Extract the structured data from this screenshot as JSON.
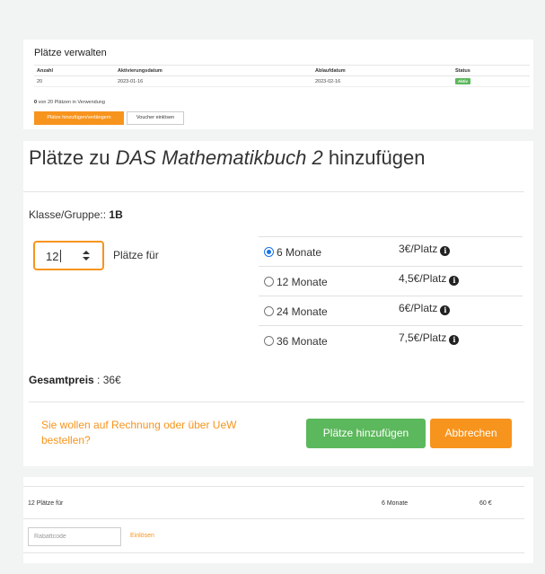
{
  "manage": {
    "title": "Plätze verwalten",
    "headers": [
      "Anzahl",
      "Aktivierungsdatum",
      "Ablaufdatum",
      "Status"
    ],
    "row": {
      "count": "20",
      "activation": "2023-01-16",
      "expiry": "2023-02-16",
      "status": "Aktiv"
    },
    "usage_count": "0",
    "usage_text": " von 20 Plätzen in Verwendung",
    "add_extend_label": "Plätze hinzufügen/verlängern",
    "voucher_label": "Voucher einlösen"
  },
  "add": {
    "title_prefix": "Plätze zu ",
    "title_book": "DAS Mathematikbuch 2",
    "title_suffix": " hinzufügen",
    "class_label": "Klasse/Gruppe:: ",
    "class_value": "1B",
    "quantity": "12",
    "places_for": "Plätze für",
    "options": [
      {
        "label": "6 Monate",
        "price": "3€/Platz",
        "selected": true
      },
      {
        "label": "12 Monate",
        "price": "4,5€/Platz",
        "selected": false
      },
      {
        "label": "24 Monate",
        "price": "6€/Platz",
        "selected": false
      },
      {
        "label": "36 Monate",
        "price": "7,5€/Platz",
        "selected": false
      }
    ],
    "total_label": "Gesamtpreis",
    "total_value": " : 36€",
    "invoice_text": "Sie wollen auf Rechnung oder über UeW bestellen?",
    "submit_label": "Plätze hinzufügen",
    "cancel_label": "Abbrechen",
    "info_glyph": "i"
  },
  "summary": {
    "description": "12 Plätze für",
    "duration": "6 Monate",
    "price": "60 €",
    "coupon_placeholder": "Rabattcode",
    "redeem_label": "Einlösen"
  },
  "colors": {
    "accent": "#f7941d",
    "success": "#5cb85c",
    "radio": "#1a73e8"
  },
  "icons": {
    "info": "info-circle-icon",
    "spinner": "number-spinner-icon"
  }
}
